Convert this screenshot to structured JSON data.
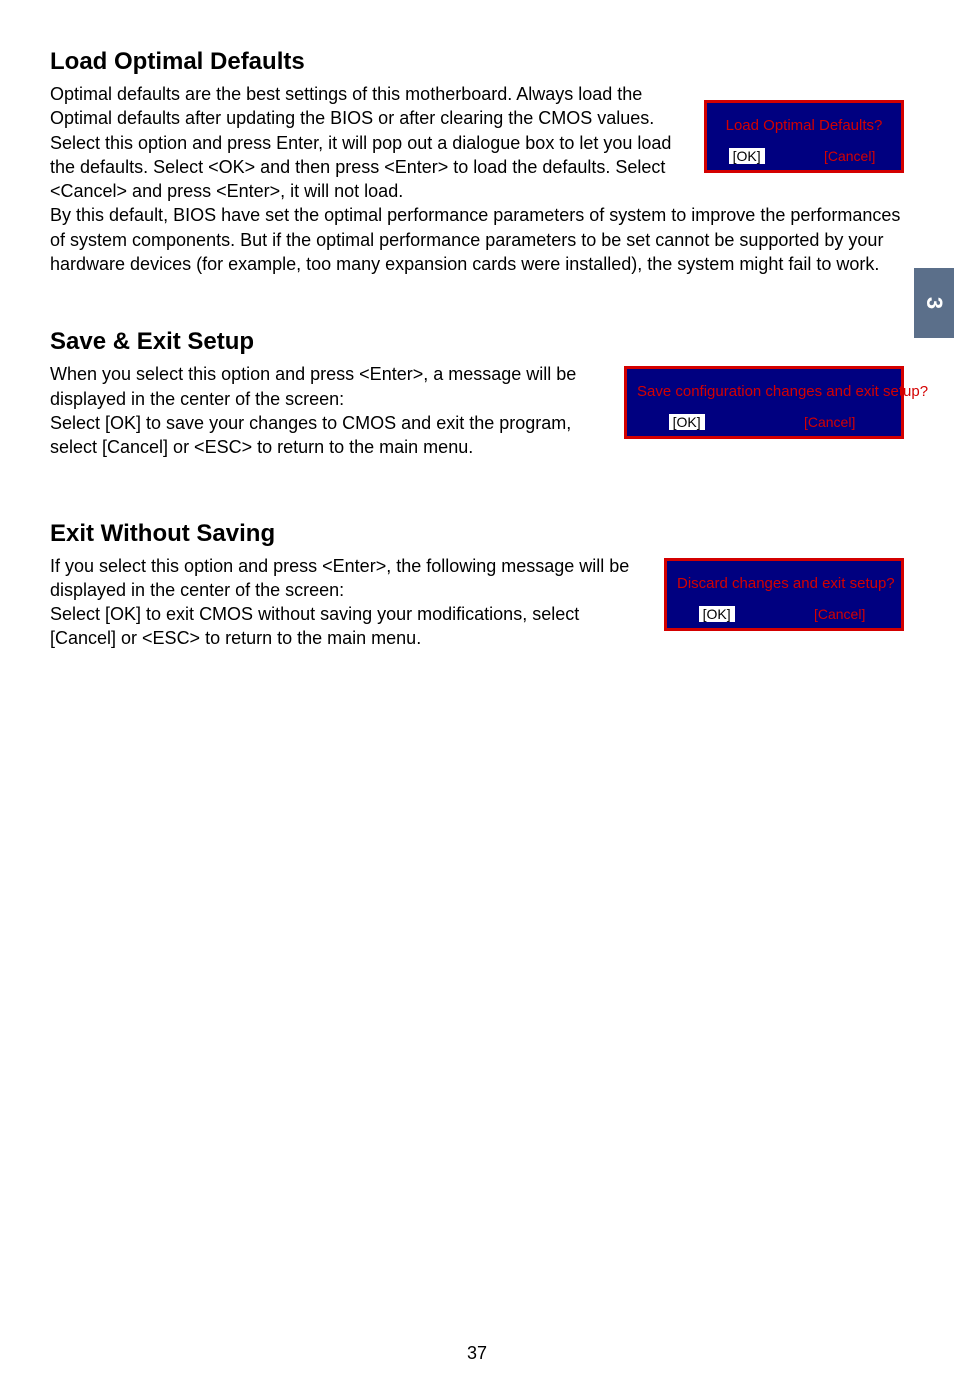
{
  "chapter_tab": "3",
  "page_number": "37",
  "section1": {
    "heading": "Load Optimal Defaults",
    "p1": "Optimal defaults are the best settings of this motherboard. Always load the Optimal defaults after updating the BIOS or after clearing the CMOS values.",
    "p2": "Select this option and press Enter, it will pop out a dialogue box to let you load the defaults. Select <OK> and then press <Enter> to load the defaults. Select <Cancel> and press <Enter>, it will not load.",
    "p3": "By this default, BIOS have set the optimal performance parameters of system to improve the performances of system components. But if the optimal performance parameters to be set cannot be supported by your hardware devices (for example, too many expansion cards were installed), the system might fail to work.",
    "dialog": {
      "title": "Load Optimal Defaults?",
      "ok": "[OK]",
      "cancel": "[Cancel]"
    }
  },
  "section2": {
    "heading": "Save & Exit Setup",
    "p1": "When you select this option and press <Enter>, a message will be displayed in the center of the screen:",
    "p2": "Select [OK] to save your changes to CMOS and exit the program, select [Cancel] or <ESC> to return to the main menu.",
    "dialog": {
      "title": "Save configuration changes and exit setup?",
      "ok": "[OK]",
      "cancel": "[Cancel]"
    }
  },
  "section3": {
    "heading": "Exit Without Saving",
    "p1": "If you select this option and press <Enter>, the following message will be displayed in the center of the screen:",
    "p2": "Select [OK] to exit CMOS without saving your modifications, select [Cancel] or <ESC> to return to the main menu.",
    "dialog": {
      "title": "Discard changes and exit setup?",
      "ok": "[OK]",
      "cancel": "[Cancel]"
    }
  }
}
